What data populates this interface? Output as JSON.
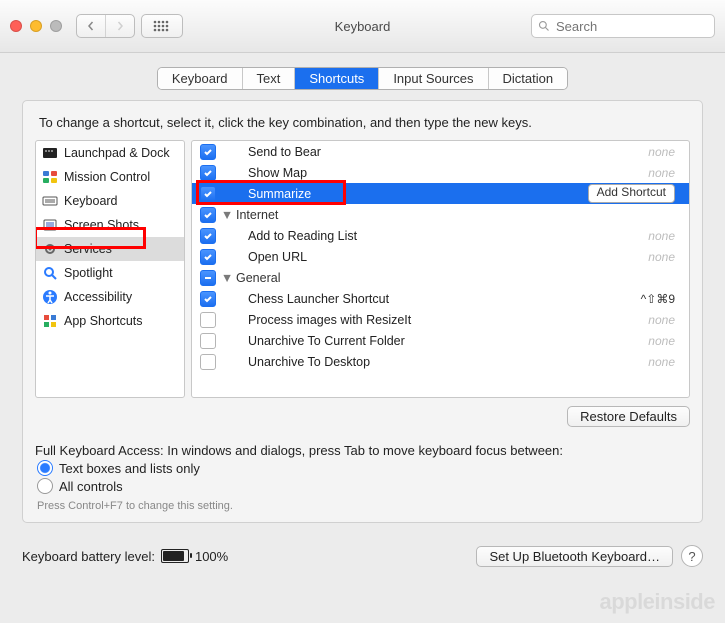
{
  "window": {
    "title": "Keyboard"
  },
  "search": {
    "placeholder": "Search"
  },
  "tabs": [
    {
      "label": "Keyboard"
    },
    {
      "label": "Text"
    },
    {
      "label": "Shortcuts"
    },
    {
      "label": "Input Sources"
    },
    {
      "label": "Dictation"
    }
  ],
  "instructions": "To change a shortcut, select it, click the key combination, and then type the new keys.",
  "categories": [
    {
      "label": "Launchpad & Dock",
      "icon": "launchpad"
    },
    {
      "label": "Mission Control",
      "icon": "mission"
    },
    {
      "label": "Keyboard",
      "icon": "keyboard"
    },
    {
      "label": "Screen Shots",
      "icon": "screenshot"
    },
    {
      "label": "Services",
      "icon": "gear"
    },
    {
      "label": "Spotlight",
      "icon": "spotlight"
    },
    {
      "label": "Accessibility",
      "icon": "accessibility"
    },
    {
      "label": "App Shortcuts",
      "icon": "apps"
    }
  ],
  "services": {
    "none_label": "none",
    "add_shortcut_label": "Add Shortcut",
    "rows": [
      {
        "type": "item",
        "checked": true,
        "label": "Send to Bear",
        "right": "none"
      },
      {
        "type": "item",
        "checked": true,
        "label": "Show Map",
        "right": "none"
      },
      {
        "type": "item",
        "checked": true,
        "label": "Summarize",
        "right": "add",
        "selected": true
      },
      {
        "type": "header",
        "checked": true,
        "label": "Internet"
      },
      {
        "type": "item",
        "checked": true,
        "label": "Add to Reading List",
        "right": "none"
      },
      {
        "type": "item",
        "checked": true,
        "label": "Open URL",
        "right": "none"
      },
      {
        "type": "header",
        "checked": "minus",
        "label": "General"
      },
      {
        "type": "item",
        "checked": true,
        "label": "Chess Launcher Shortcut",
        "right": "^⇧⌘9",
        "shortcut": true
      },
      {
        "type": "item",
        "checked": false,
        "label": "Process images with ResizeIt",
        "right": "none"
      },
      {
        "type": "item",
        "checked": false,
        "label": "Unarchive To Current Folder",
        "right": "none"
      },
      {
        "type": "item",
        "checked": false,
        "label": "Unarchive To Desktop",
        "right": "none"
      }
    ]
  },
  "restore_defaults": "Restore Defaults",
  "keyboard_access": {
    "prompt": "Full Keyboard Access: In windows and dialogs, press Tab to move keyboard focus between:",
    "opt1": "Text boxes and lists only",
    "opt2": "All controls",
    "hint": "Press Control+F7 to change this setting."
  },
  "footer": {
    "battery_label": "Keyboard battery level:",
    "battery_pct": "100%",
    "bluetooth_btn": "Set Up Bluetooth Keyboard…",
    "help": "?"
  },
  "watermark": "appleinside"
}
